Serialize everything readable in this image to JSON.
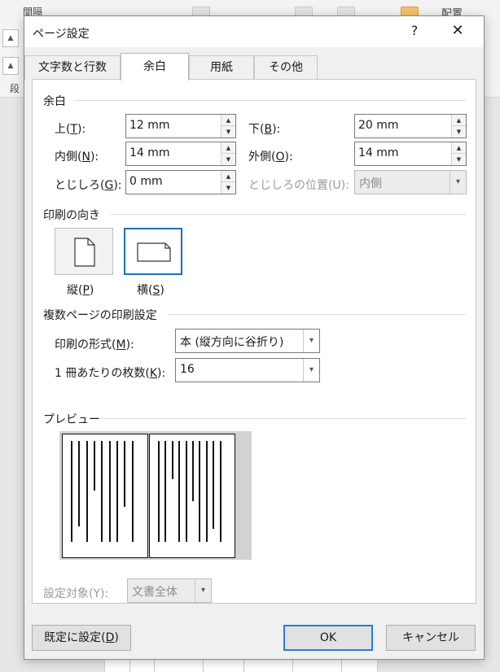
{
  "background": {
    "ribbon_label_1": "間隔",
    "ribbon_label_2": "段",
    "ribbon_arrange": "配置"
  },
  "dialog": {
    "title": "ページ設定",
    "help_label": "?",
    "close_label": "✕",
    "tabs": [
      {
        "label": "文字数と行数",
        "active": false
      },
      {
        "label": "余白",
        "active": true
      },
      {
        "label": "用紙",
        "active": false
      },
      {
        "label": "その他",
        "active": false
      }
    ]
  },
  "margins": {
    "section_title": "余白",
    "top": {
      "label": "上(",
      "key": "T",
      "suffix": "):",
      "value": "12 mm"
    },
    "bottom": {
      "label": "下(",
      "key": "B",
      "suffix": "):",
      "value": "20 mm"
    },
    "inside": {
      "label": "内側(",
      "key": "N",
      "suffix": "):",
      "value": "14 mm"
    },
    "outside": {
      "label": "外側(",
      "key": "O",
      "suffix": "):",
      "value": "14 mm"
    },
    "gutter": {
      "label": "とじしろ(",
      "key": "G",
      "suffix": "):",
      "value": "0 mm"
    },
    "gutter_position": {
      "label": "とじしろの位置(U):",
      "value": "内側",
      "disabled": true
    }
  },
  "orientation": {
    "section_title": "印刷の向き",
    "portrait": {
      "label": "縦(",
      "key": "P",
      "suffix": ")",
      "selected": false
    },
    "landscape": {
      "label": "横(",
      "key": "S",
      "suffix": ")",
      "selected": true
    }
  },
  "multiple_pages": {
    "section_title": "複数ページの印刷設定",
    "format": {
      "label": "印刷の形式(",
      "key": "M",
      "suffix": "):",
      "value": "本 (縦方向に谷折り)"
    },
    "sheets_per_booklet": {
      "label": "1 冊あたりの枚数(",
      "key": "K",
      "suffix": "):",
      "value": "16"
    }
  },
  "preview": {
    "section_title": "プレビュー",
    "left_page_line_lengths": [
      0.92,
      0.78,
      0.92,
      0.45,
      0.92,
      0.92,
      0.92,
      0.6,
      0.92
    ],
    "right_page_line_lengths": [
      0.92,
      0.92,
      0.35,
      0.92,
      0.92,
      0.55,
      0.92,
      0.92,
      0.8,
      0.92
    ]
  },
  "apply_to": {
    "label": "設定対象(Y):",
    "value": "文書全体",
    "disabled": true
  },
  "buttons": {
    "set_default": {
      "label": "既定に設定(",
      "key": "D",
      "suffix": ")"
    },
    "ok": "OK",
    "cancel": "キャンセル"
  }
}
